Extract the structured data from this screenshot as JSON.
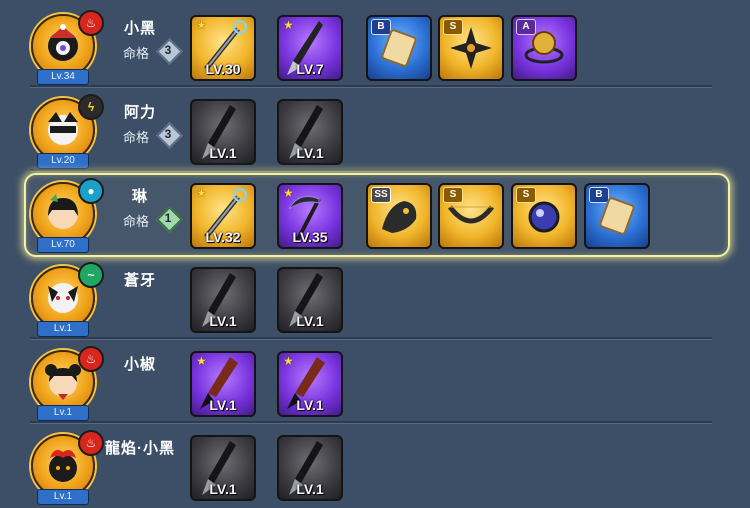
{
  "characters": [
    {
      "name": "小黑",
      "level": "Lv.34",
      "element": "fire",
      "fate_label": "命格",
      "fate": "3",
      "weapons": [
        {
          "level": "LV.30",
          "rarity": "gold"
        },
        {
          "level": "LV.7",
          "rarity": "purple"
        }
      ],
      "items": [
        {
          "grade": "B",
          "rarity": "blue",
          "icon": "scroll-icon"
        },
        {
          "grade": "S",
          "rarity": "gold",
          "icon": "shuriken-icon"
        },
        {
          "grade": "A",
          "rarity": "purple",
          "icon": "orb-ring-icon"
        }
      ]
    },
    {
      "name": "阿力",
      "level": "Lv.20",
      "element": "thunder",
      "fate_label": "命格",
      "fate": "3",
      "weapons": [
        {
          "level": "LV.1",
          "rarity": "gray"
        },
        {
          "level": "LV.1",
          "rarity": "gray"
        }
      ],
      "items": []
    },
    {
      "name": "琳",
      "level": "Lv.70",
      "element": "water",
      "fate_label": "命格",
      "fate": "1",
      "highlighted": true,
      "weapons": [
        {
          "level": "LV.32",
          "rarity": "gold"
        },
        {
          "level": "LV.35",
          "rarity": "purple"
        }
      ],
      "items": [
        {
          "grade": "SS",
          "rarity": "gold",
          "icon": "beast-icon"
        },
        {
          "grade": "S",
          "rarity": "gold",
          "icon": "bow-icon"
        },
        {
          "grade": "S",
          "rarity": "gold",
          "icon": "dark-orb-icon"
        },
        {
          "grade": "B",
          "rarity": "blue",
          "icon": "scroll-icon"
        }
      ]
    },
    {
      "name": "蒼牙",
      "level": "Lv.1",
      "element": "wind",
      "weapons": [
        {
          "level": "LV.1",
          "rarity": "gray"
        },
        {
          "level": "LV.1",
          "rarity": "gray"
        }
      ],
      "items": []
    },
    {
      "name": "小椒",
      "level": "Lv.1",
      "element": "fire",
      "weapons": [
        {
          "level": "LV.1",
          "rarity": "purple"
        },
        {
          "level": "LV.1",
          "rarity": "purple"
        }
      ],
      "items": []
    },
    {
      "name": "龍焰·小黑",
      "level": "Lv.1",
      "element": "fire",
      "weapons": [
        {
          "level": "LV.1",
          "rarity": "gray"
        },
        {
          "level": "LV.1",
          "rarity": "gray"
        }
      ],
      "items": []
    }
  ],
  "colors": {
    "accent_highlight": "#f6f0a0",
    "background": "#3d4f66",
    "level_badge": "#2f6fc8"
  }
}
